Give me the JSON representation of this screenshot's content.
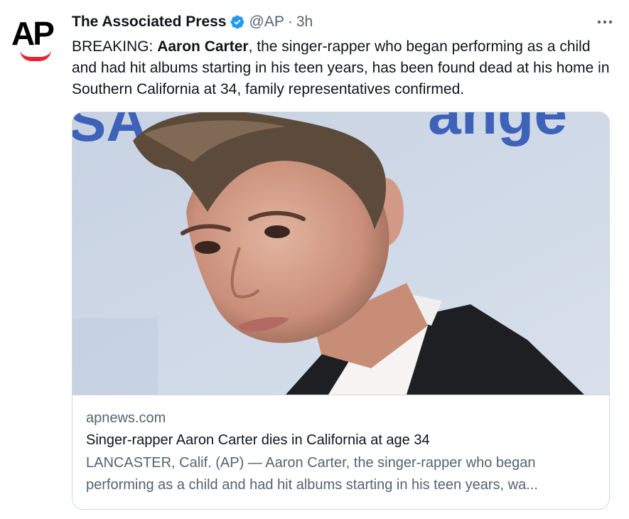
{
  "tweet": {
    "avatar_text": "AP",
    "name": "The Associated Press",
    "handle": "@AP",
    "separator": "·",
    "time": "3h",
    "more_icon": "ellipsis-icon",
    "text_prefix": "BREAKING: ",
    "text_bold": "Aaron Carter",
    "text_rest": ", the singer-rapper who began performing as a child and had hit albums starting in his teen years, has been found dead at his home in Southern California at 34, family representatives confirmed."
  },
  "card": {
    "domain": "apnews.com",
    "title": "Singer-rapper Aaron Carter dies in California at age 34",
    "description": "LANCASTER, Calif. (AP) — Aaron Carter, the singer-rapper who began performing as a child and had hit albums starting in his teen years, wa...",
    "backdrop_text": "SA  ange"
  },
  "colors": {
    "verified": "#1d9bf0",
    "ap_red": "#e8262d",
    "text_secondary": "#536471",
    "border": "#cfd9de"
  }
}
